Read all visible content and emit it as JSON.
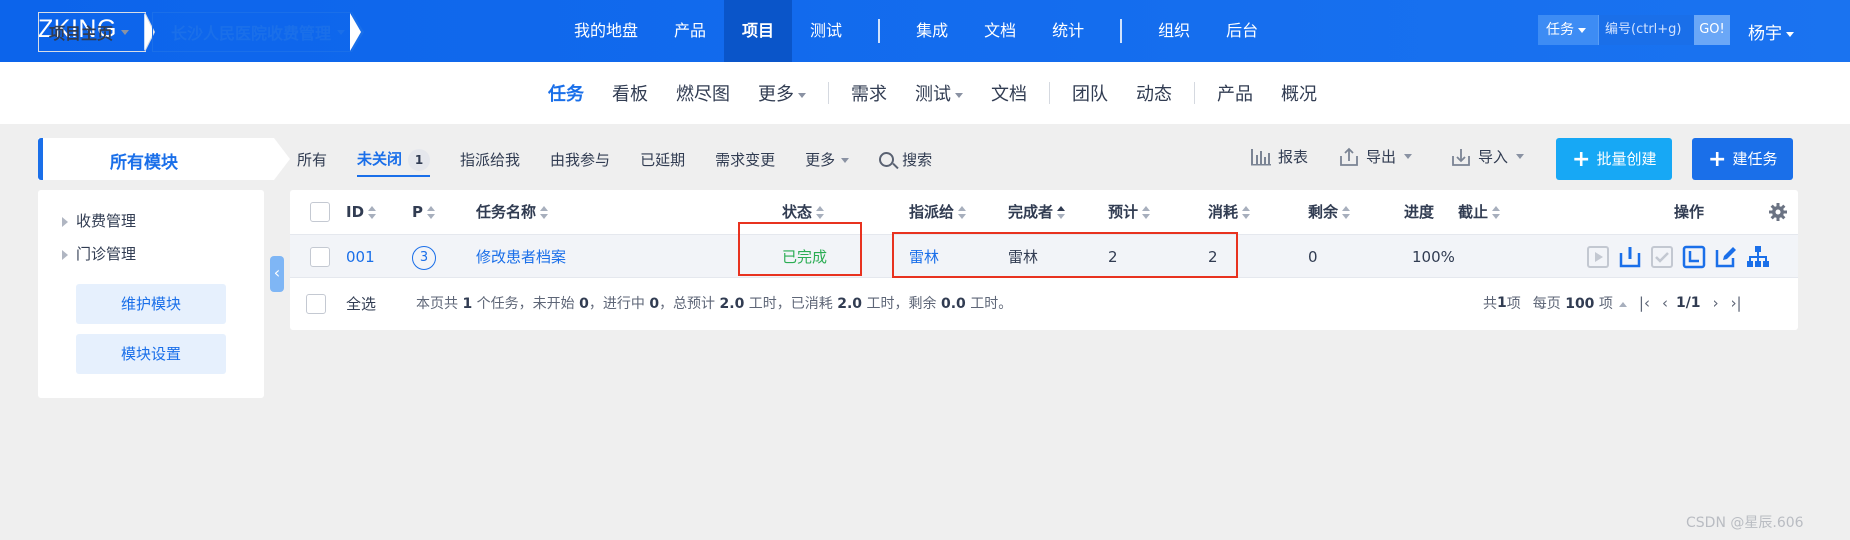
{
  "app": {
    "logo": "ZKING"
  },
  "top_nav": {
    "items": [
      {
        "label": "我的地盘"
      },
      {
        "label": "产品"
      },
      {
        "label": "项目",
        "active": true
      },
      {
        "label": "测试"
      },
      {
        "label": "集成"
      },
      {
        "label": "文档"
      },
      {
        "label": "统计"
      },
      {
        "label": "组织"
      },
      {
        "label": "后台"
      }
    ],
    "search": {
      "type": "任务",
      "placeholder": "编号(ctrl+g)",
      "go": "GO!"
    },
    "user": "杨宇"
  },
  "breadcrumb": {
    "home": "项目主页",
    "project": "长沙人民医院收费管理"
  },
  "sub_nav": {
    "items": [
      "任务",
      "看板",
      "燃尽图",
      "更多",
      "需求",
      "测试",
      "文档",
      "团队",
      "动态",
      "产品",
      "概况"
    ],
    "active": "任务"
  },
  "sidebar": {
    "title": "所有模块",
    "tree": [
      "收费管理",
      "门诊管理"
    ],
    "buttons": [
      "维护模块",
      "模块设置"
    ]
  },
  "feature_bar": {
    "tabs": [
      {
        "label": "所有"
      },
      {
        "label": "未关闭",
        "count": "1",
        "active": true
      },
      {
        "label": "指派给我"
      },
      {
        "label": "由我参与"
      },
      {
        "label": "已延期"
      },
      {
        "label": "需求变更"
      },
      {
        "label": "更多"
      }
    ],
    "search": "搜索",
    "tools": {
      "report": "报表",
      "export": "导出",
      "import": "导入"
    },
    "batch_create": "批量创建",
    "create_task": "建任务"
  },
  "table": {
    "headers": {
      "id": "ID",
      "pri": "P",
      "name": "任务名称",
      "status": "状态",
      "assigned": "指派给",
      "finished_by": "完成者",
      "estimate": "预计",
      "consumed": "消耗",
      "left": "剩余",
      "progress": "进度",
      "deadline": "截止",
      "actions": "操作"
    },
    "rows": [
      {
        "id": "001",
        "pri": "3",
        "name": "修改患者档案",
        "status": "已完成",
        "assigned": "雷林",
        "finished_by": "雷林",
        "estimate": "2",
        "consumed": "2",
        "left": "0",
        "progress": "100%",
        "deadline": ""
      }
    ],
    "select_all": "全选",
    "summary": {
      "p1": "本页共 ",
      "tasks": "1",
      "p2": " 个任务，未开始 ",
      "wait": "0",
      "p3": "，进行中 ",
      "doing": "0",
      "p4": "，总预计 ",
      "estimate": "2.0",
      "p5": " 工时，已消耗 ",
      "consumed": "2.0",
      "p6": " 工时，剩余 ",
      "left": "0.0",
      "p7": " 工时。"
    },
    "pager": {
      "total_prefix": "共 ",
      "total": "1",
      "total_suffix": " 项",
      "per_page_prefix": "每页 ",
      "per_page": "100",
      "per_page_suffix": " 项",
      "page": "1/1"
    }
  },
  "watermark": "CSDN @星辰.606",
  "colors": {
    "primary": "#1a6fe9",
    "done": "#2bad53",
    "highlight": "#e8321f",
    "accent_button": "#17a8f5"
  }
}
